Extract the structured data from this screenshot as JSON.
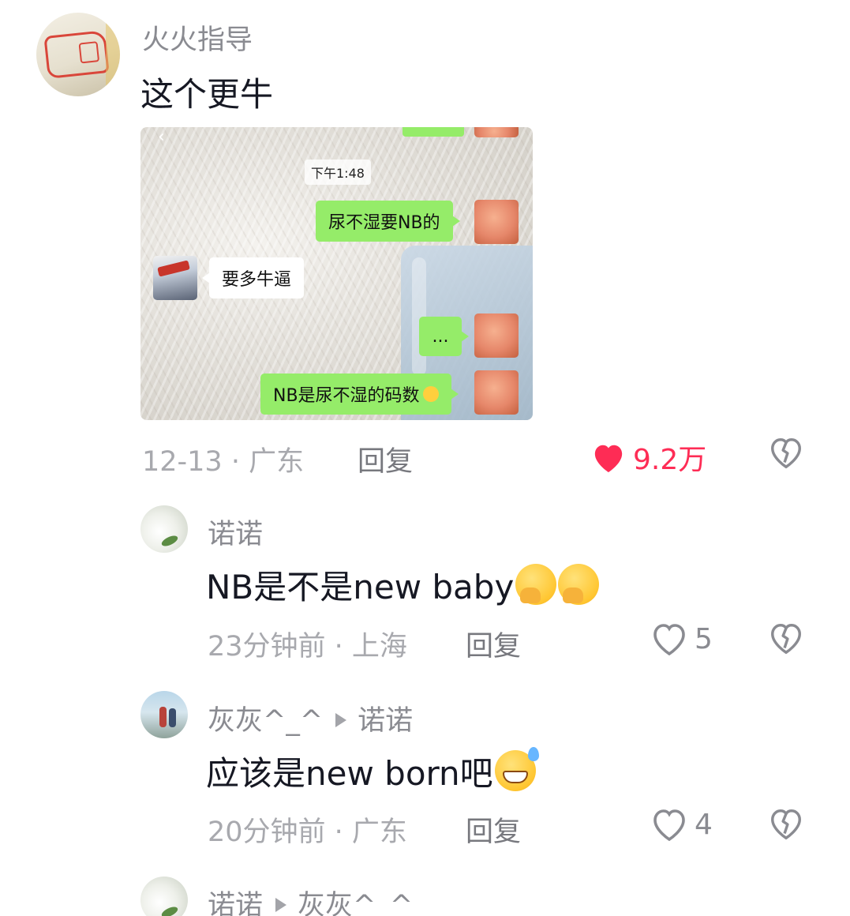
{
  "main_comment": {
    "username": "火火指导",
    "text": "这个更牛",
    "image": {
      "time": "下午1:48",
      "messages": [
        {
          "side": "me",
          "text": "尿不湿要NB的"
        },
        {
          "side": "other",
          "text": "要多牛逼"
        },
        {
          "side": "me",
          "text": "..."
        },
        {
          "side": "me",
          "text": "NB是尿不湿的码数"
        }
      ]
    },
    "meta": "12-13 · 广东",
    "reply_label": "回复",
    "like_count": "9.2万"
  },
  "replies": [
    {
      "username": "诺诺",
      "text": "NB是不是new baby",
      "meta": "23分钟前 · 上海",
      "reply_label": "回复",
      "like_count": "5"
    },
    {
      "username": "灰灰^_^",
      "reply_to": "诺诺",
      "text": "应该是new born吧",
      "meta": "20分钟前 · 广东",
      "reply_label": "回复",
      "like_count": "4"
    },
    {
      "username": "诺诺",
      "reply_to": "灰灰^_^"
    }
  ],
  "colors": {
    "like_active": "#fe2c55",
    "name_text": "#8a8b91",
    "meta_text": "#a8a9ae",
    "body_text": "#161823",
    "wechat_green": "#95ec69"
  },
  "icons": {
    "like": "heart-icon",
    "dislike": "broken-heart-icon",
    "emoji_cover_mouth": "hand-over-mouth-emoji",
    "emoji_sweat_grin": "grinning-sweat-emoji"
  }
}
